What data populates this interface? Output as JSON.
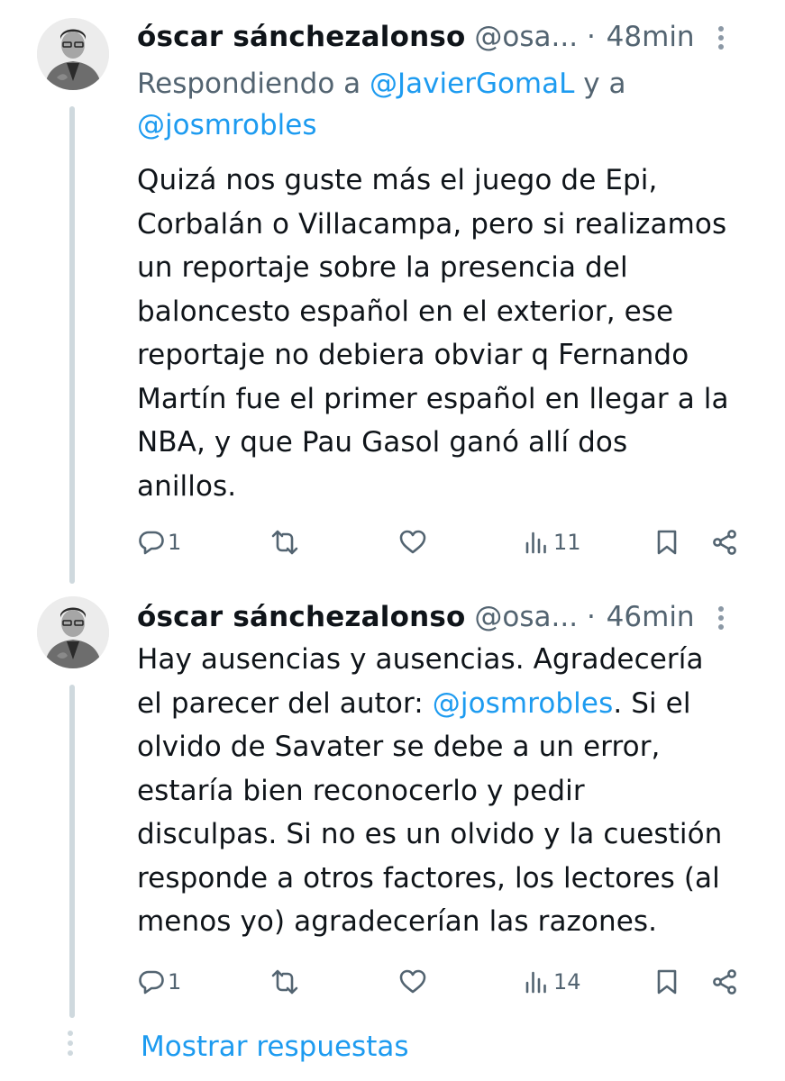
{
  "tweets": [
    {
      "author_name": "óscar sánchezalonso",
      "handle": "@osa...",
      "separator": "·",
      "time": "48min",
      "reply_prefix": "Respondiendo a ",
      "reply_mention_1": "@JavierGomaL",
      "reply_joiner": " y a",
      "reply_mention_2": "@josmrobles",
      "text": "Quizá nos guste más el juego de Epi,\nCorbalán o Villacampa, pero si realizamos\nun reportaje sobre la presencia del\nbaloncesto español en el exterior, ese\nreportaje no debiera obviar q Fernando\nMartín fue el primer español en llegar a la\nNBA, y que Pau Gasol ganó allí dos\nanillos.",
      "reply_count": "1",
      "views_count": "11"
    },
    {
      "author_name": "óscar sánchezalonso",
      "handle": "@osa...",
      "separator": "·",
      "time": "46min",
      "text_before_mention": "Hay ausencias y ausencias. Agradecería\nel parecer del autor: ",
      "text_mention": "@josmrobles",
      "text_after_mention": ". Si el\nolvido de Savater se debe a un error,\nestaría bien reconocerlo y pedir\ndisculpas. Si no es un olvido y la cuestión\nresponde a otros factores, los lectores (al\nmenos yo) agradecerían las razones.",
      "reply_count": "1",
      "views_count": "14"
    }
  ],
  "show_replies_label": "Mostrar respuestas",
  "icons": [
    "reply-icon",
    "retweet-icon",
    "like-icon",
    "views-icon",
    "bookmark-icon",
    "share-icon",
    "more-icon"
  ],
  "colors": {
    "link": "#1d9bf0",
    "secondary_text": "#536471",
    "thread_line": "#cfd9de"
  }
}
